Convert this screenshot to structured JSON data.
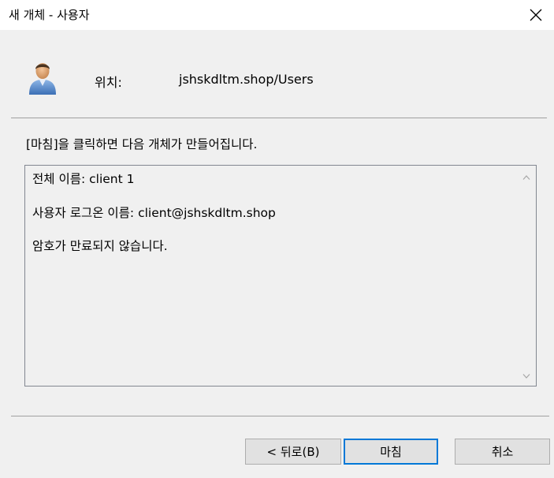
{
  "window": {
    "title": "새 개체 - 사용자",
    "close_icon": "close-icon"
  },
  "header": {
    "icon": "user-icon",
    "location_label": "위치:",
    "location_value": "jshskdltm.shop/Users"
  },
  "instruction": "[마침]을 클릭하면 다음 개체가 만들어집니다.",
  "summary": {
    "lines": [
      "전체 이름: client 1",
      "사용자 로그온 이름: client@jshskdltm.shop",
      "암호가 만료되지 않습니다."
    ]
  },
  "buttons": {
    "back": "< 뒤로(B)",
    "finish": "마침",
    "cancel": "취소"
  },
  "colors": {
    "default_button_border": "#0078d7",
    "dialog_background": "#f0f0f0"
  }
}
